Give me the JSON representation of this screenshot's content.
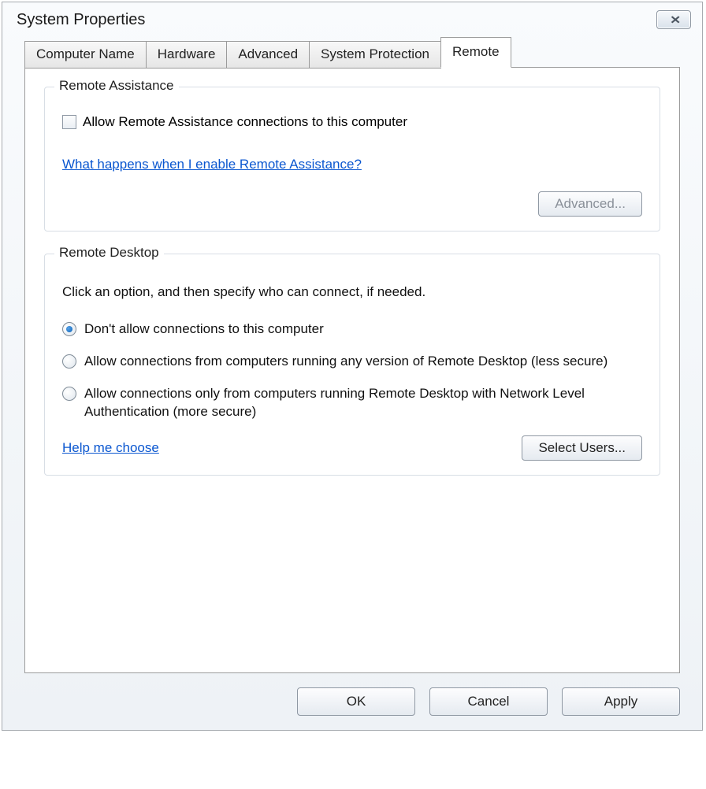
{
  "window": {
    "title": "System Properties"
  },
  "tabs": [
    {
      "label": "Computer Name",
      "active": false
    },
    {
      "label": "Hardware",
      "active": false
    },
    {
      "label": "Advanced",
      "active": false
    },
    {
      "label": "System Protection",
      "active": false
    },
    {
      "label": "Remote",
      "active": true
    }
  ],
  "remote_assistance": {
    "legend": "Remote Assistance",
    "checkbox_label": "Allow Remote Assistance connections to this computer",
    "checkbox_checked": false,
    "help_link": "What happens when I enable Remote Assistance?",
    "advanced_button": "Advanced...",
    "advanced_enabled": false
  },
  "remote_desktop": {
    "legend": "Remote Desktop",
    "description": "Click an option, and then specify who can connect, if needed.",
    "options": [
      {
        "label": "Don't allow connections to this computer",
        "checked": true
      },
      {
        "label": "Allow connections from computers running any version of Remote Desktop (less secure)",
        "checked": false
      },
      {
        "label": "Allow connections only from computers running Remote Desktop with Network Level Authentication (more secure)",
        "checked": false
      }
    ],
    "help_link": "Help me choose",
    "select_users_button": "Select Users..."
  },
  "dialog_buttons": {
    "ok": "OK",
    "cancel": "Cancel",
    "apply": "Apply"
  }
}
